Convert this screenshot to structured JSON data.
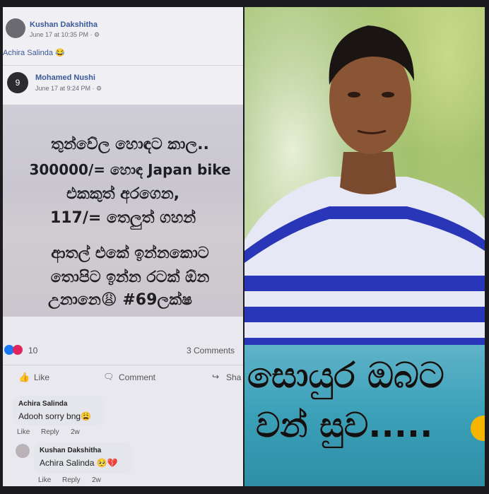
{
  "post": {
    "author1": "Kushan Dakshitha",
    "time1": "June 17 at 10:35 PM · ⚙",
    "mention1": "Achira Salinda 😂",
    "author2": "Mohamed Nushi",
    "time2": "June 17 at 9:24 PM · ⚙",
    "avatar2_label": "9"
  },
  "meme": {
    "lines": [
      "තුන්වේල හොඳට කාල..",
      "300000/= හොඳ Japan bike",
      "එකකුත් අරගෙන,",
      "117/= තෙලුත් ගහන්",
      "ආතල් එකේ ඉන්නකොට",
      "තොපිට ඉන්න රටක් ඕන",
      "උනානෙ😩 #69ලක්ෂ"
    ]
  },
  "reactions": {
    "count": "10",
    "comments": "3 Comments"
  },
  "actions": {
    "like": "Like",
    "comment": "Comment",
    "share": "Sha"
  },
  "comments": [
    {
      "name": "Achira Salinda",
      "text": "Adooh sorry bng😩",
      "like": "Like",
      "reply": "Reply",
      "age": "2w"
    },
    {
      "name": "Kushan Dakshitha",
      "text": "Achira Salinda 🥺💔",
      "like": "Like",
      "reply": "Reply",
      "age": "2w"
    }
  ],
  "banner": {
    "line1": "සොයුර ඔබට",
    "line2": "වන් සුව....."
  },
  "colors": {
    "fb_blue": "#3b5998",
    "banner": "#3aa0b8",
    "shirt_blue": "#2a36b8"
  }
}
